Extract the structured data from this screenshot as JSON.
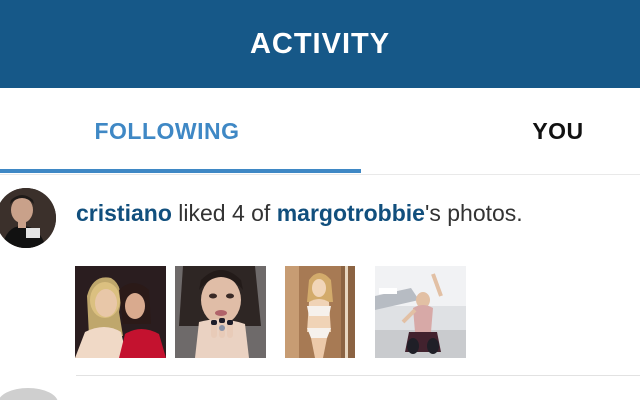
{
  "header": {
    "title": "ACTIVITY"
  },
  "tabs": [
    {
      "label": "FOLLOWING",
      "active": true
    },
    {
      "label": "YOU",
      "active": false
    }
  ],
  "feed": [
    {
      "actor": "cristiano",
      "text_mid": " liked 4 of ",
      "target": "margotrobbie",
      "text_end": "'s photos.",
      "photo_count": 4
    }
  ],
  "colors": {
    "header_bg": "#165888",
    "accent": "#3f88c5",
    "username": "#114f7d"
  }
}
